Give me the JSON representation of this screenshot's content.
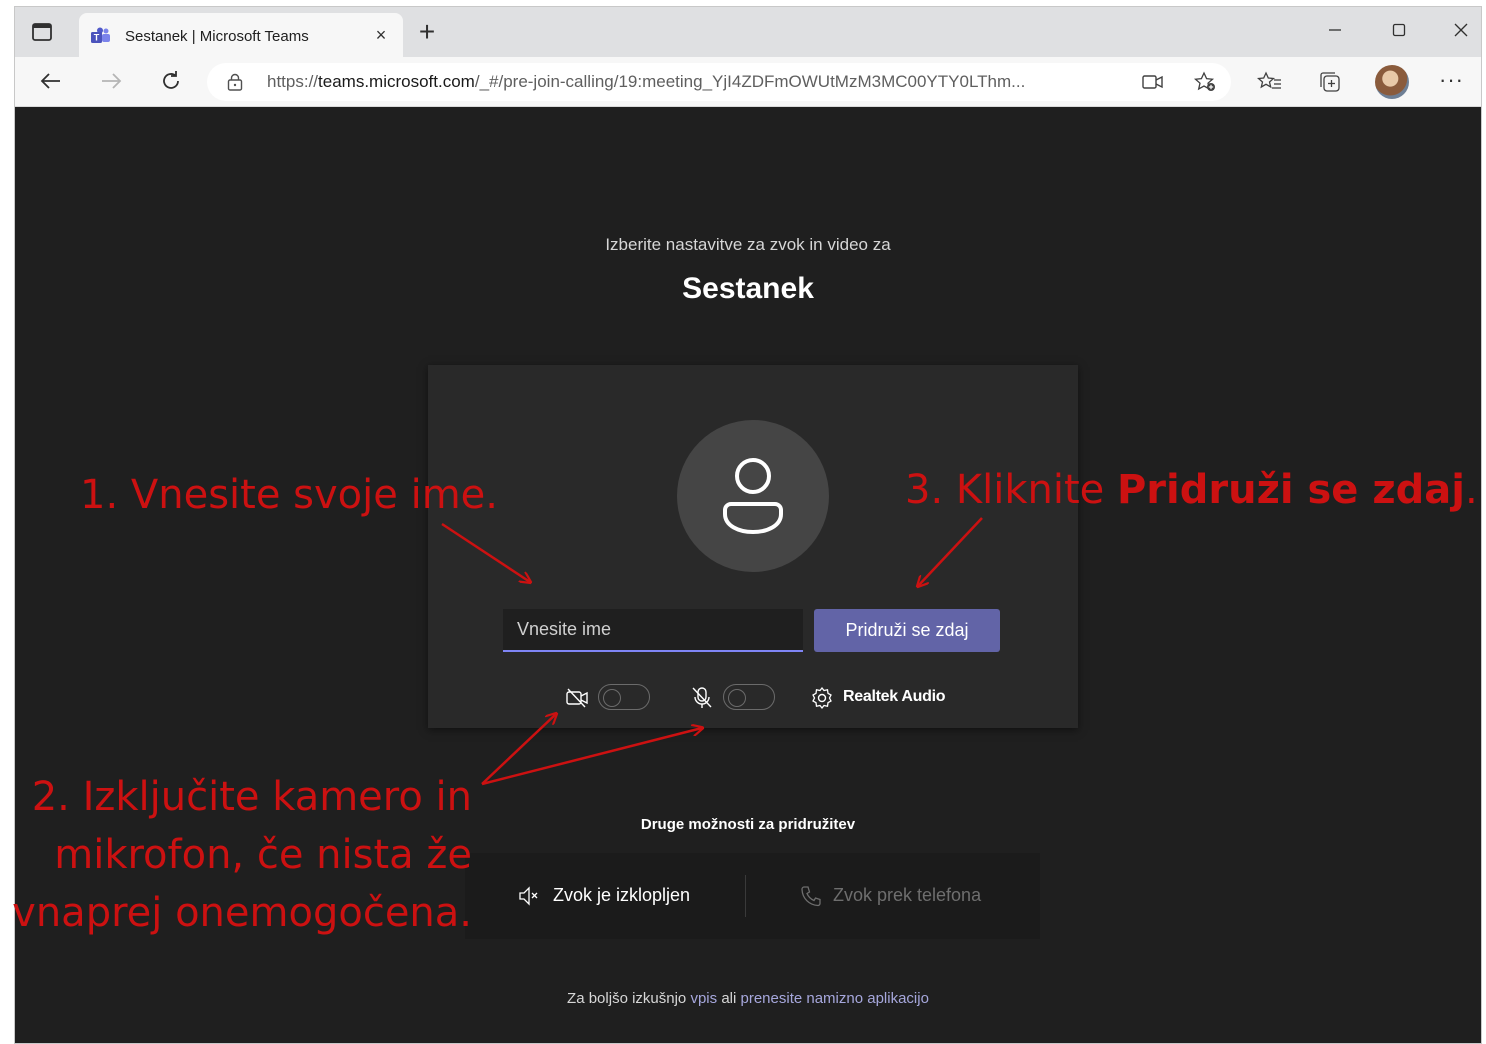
{
  "browser": {
    "tab_title": "Sestanek | Microsoft Teams",
    "url_prefix": "https://",
    "url_host": "teams.microsoft.com",
    "url_rest": "/_#/pre-join-calling/19:meeting_YjI4ZDFmOWUtMzM3MC00YTY0LThm...",
    "new_tab_glyph": "+",
    "close_glyph": "×",
    "more_glyph": "···"
  },
  "prejoin": {
    "subtitle": "Izberite nastavitve za zvok in video za",
    "meeting_title": "Sestanek",
    "name_placeholder": "Vnesite ime",
    "join_button": "Pridruži se zdaj",
    "audio_device": "Realtek Audio",
    "camera_on": false,
    "mic_on": false
  },
  "other_options": {
    "label": "Druge možnosti za pridružitev",
    "audio_off": "Zvok je izklopljen",
    "phone_audio": "Zvok prek telefona"
  },
  "footer": {
    "prefix": "Za boljšo izkušnjo",
    "signin_link": "vpis",
    "middle": "ali",
    "download_link": "prenesite namizno aplikacijo"
  },
  "annotations": {
    "step1": "1. Vnesite svoje ime.",
    "step2_line1": "2. Izključite kamero in",
    "step2_line2": "mikrofon, če nista že",
    "step2_line3": "vnaprej onemogočena.",
    "step3_prefix": "3. Kliknite ",
    "step3_bold": "Pridruži se zdaj",
    "step3_suffix": "."
  },
  "colors": {
    "accent": "#6264a7",
    "annotation": "#cc1111",
    "background": "#1f1f1f",
    "card": "#292929"
  }
}
